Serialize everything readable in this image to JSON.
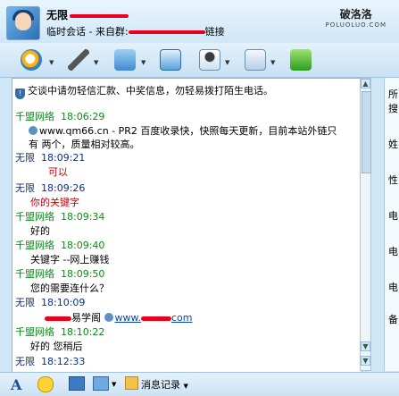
{
  "window": {
    "title_name": "无限",
    "subtitle_prefix": "临时会话 - 来自群:",
    "subtitle_suffix": "链接",
    "watermark_main": "破洛洛",
    "watermark_sub": "POLUOLUO.COM"
  },
  "toolbar": {
    "icons": [
      "video-call-icon",
      "voice-call-icon",
      "send-file-icon",
      "remote-assist-icon",
      "user-info-icon",
      "app-icon",
      "add-contact-icon"
    ]
  },
  "notice": {
    "text": "交谈中请勿轻信汇款、中奖信息，勿轻易拨打陌生电话。"
  },
  "messages": [
    {
      "sender": "千盟网络",
      "time": "18:06:29",
      "color": "#0a8a1a",
      "lines": [
        "www.qm66.cn - PR2 百度收录快，快照每天更新，目前本站外链只",
        "有 两个，质量相对较高。"
      ],
      "link": "www.qm66.cn"
    },
    {
      "sender": "无限",
      "time": "18:09:21",
      "color": "#0b2e8a",
      "lines": [
        "可以"
      ],
      "text_color": "#c3000d"
    },
    {
      "sender": "无限",
      "time": "18:09:26",
      "color": "#0b2e8a",
      "lines": [
        "你的关键字"
      ],
      "text_color": "#c3000d"
    },
    {
      "sender": "千盟网络",
      "time": "18:09:34",
      "color": "#0a8a1a",
      "lines": [
        "好的"
      ]
    },
    {
      "sender": "千盟网络",
      "time": "18:09:40",
      "color": "#0a8a1a",
      "lines": [
        "关键字 --网上赚钱"
      ]
    },
    {
      "sender": "千盟网络",
      "time": "18:09:50",
      "color": "#0a8a1a",
      "lines": [
        "您的需要连什么？"
      ]
    },
    {
      "sender": "无限",
      "time": "18:10:09",
      "color": "#0b2e8a",
      "lines": [
        "易学阁"
      ],
      "link": "www.",
      "link_tail": "com"
    },
    {
      "sender": "千盟网络",
      "time": "18:10:22",
      "color": "#0a8a1a",
      "lines": [
        "好的  您稍后"
      ]
    },
    {
      "sender": "无限",
      "time": "18:12:33",
      "color": "#0b2e8a",
      "lines": []
    }
  ],
  "sidepane": [
    "所",
    "搜",
    "姓",
    "性",
    "电",
    "电",
    "电",
    "备"
  ],
  "bottombar": {
    "font_label": "A",
    "history_label": "消息记录"
  }
}
